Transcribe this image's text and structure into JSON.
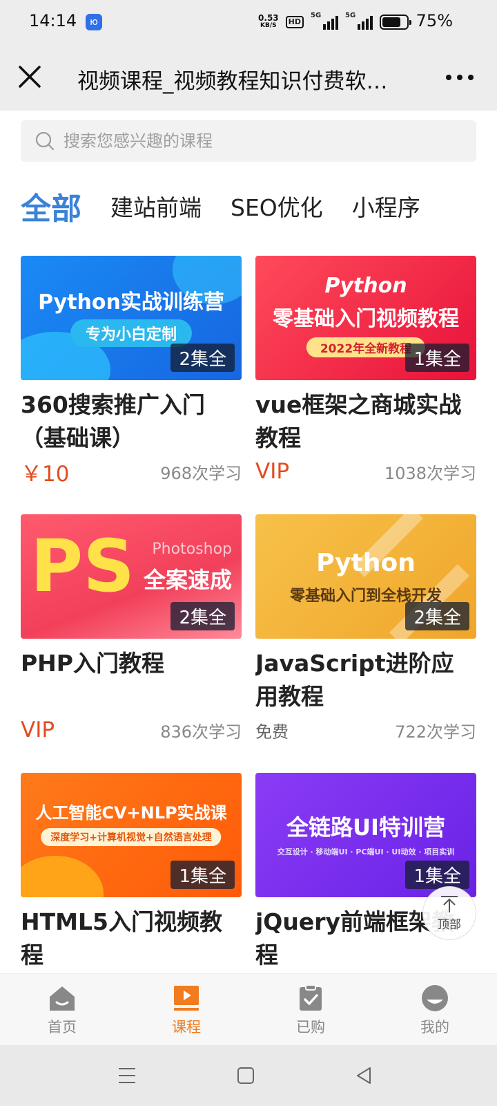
{
  "status_bar": {
    "time": "14:14",
    "net_speed_value": "0.53",
    "net_speed_unit": "KB/S",
    "hd": "HD",
    "signal1_label": "5G",
    "signal2_label": "5G",
    "battery_percent": "75%",
    "battery_level": 0.75
  },
  "title_bar": {
    "title": "视频课程_视频教程知识付费软…"
  },
  "search": {
    "placeholder": "搜索您感兴趣的课程"
  },
  "tabs": [
    {
      "label": "全部",
      "active": true
    },
    {
      "label": "建站前端",
      "active": false
    },
    {
      "label": "SEO优化",
      "active": false
    },
    {
      "label": "小程序",
      "active": false
    }
  ],
  "courses": [
    {
      "thumb_title": "Python实战训练营",
      "thumb_sub": "专为小白定制",
      "episodes": "2集全",
      "name": "360搜索推广入门（基础课）",
      "price": "￥10",
      "learners": "968次学习",
      "color": "#1f7ff0"
    },
    {
      "thumb_title": "Python",
      "thumb_title2": "零基础入门视频教程",
      "thumb_sub": "2022年全新教程",
      "episodes": "1集全",
      "name": "vue框架之商城实战教程",
      "price": "VIP",
      "learners": "1038次学习",
      "color": "#f0263f"
    },
    {
      "thumb_title": "PS",
      "thumb_title2": "Photoshop",
      "thumb_sub": "全案速成",
      "episodes": "2集全",
      "name": "PHP入门教程",
      "price": "VIP",
      "learners": "836次学习",
      "color": "#f2405a"
    },
    {
      "thumb_title": "Python",
      "thumb_sub": "零基础入门到全栈开发",
      "episodes": "2集全",
      "name": "JavaScript进阶应用教程",
      "price": "免费",
      "learners": "722次学习",
      "color": "#f3b531"
    },
    {
      "thumb_title": "人工智能CV+NLP实战课",
      "thumb_sub": "深度学习+计算机视觉+自然语言处理",
      "episodes": "1集全",
      "name": "HTML5入门视频教程",
      "color": "#ff6a10"
    },
    {
      "thumb_title": "全链路UI特训营",
      "thumb_sub": "交互设计 · 移动端UI · PC端UI · UI动效 · 项目实训",
      "episodes": "1集全",
      "name": "jQuery前端框架教程",
      "color": "#7b2ff0"
    }
  ],
  "back_to_top": {
    "label": "顶部"
  },
  "bottom_nav": [
    {
      "label": "首页",
      "icon": "home-icon",
      "active": false
    },
    {
      "label": "课程",
      "icon": "course-icon",
      "active": true
    },
    {
      "label": "已购",
      "icon": "purchased-icon",
      "active": false
    },
    {
      "label": "我的",
      "icon": "profile-icon",
      "active": false
    }
  ],
  "colors": {
    "accent_blue": "#3b82d8",
    "price_red": "#e24c1e",
    "nav_active": "#f07c1f"
  }
}
